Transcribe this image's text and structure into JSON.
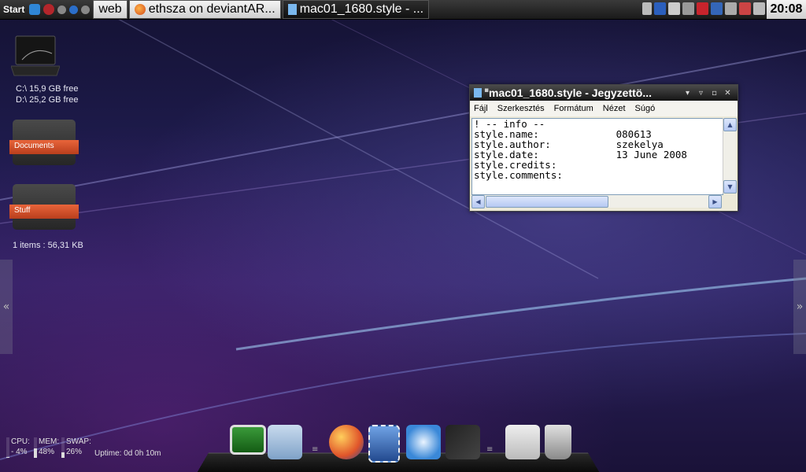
{
  "taskbar": {
    "start_label": "Start",
    "tasks": [
      {
        "label": "web"
      },
      {
        "label": "ethsza on deviantAR..."
      },
      {
        "label": "mac01_1680.style - ...",
        "active": true
      }
    ],
    "clock": "20:08"
  },
  "desktop": {
    "drives": [
      "C:\\ 15,9 GB free",
      "D:\\ 25,2 GB free"
    ],
    "folders": [
      {
        "label": "Documents"
      },
      {
        "label": "Stuff"
      }
    ],
    "items_info": "1 items : 56,31 KB",
    "left_arrow": "«",
    "right_arrow": "»"
  },
  "notepad": {
    "title": "mac01_1680.style - Jegyzettö...",
    "menu": [
      "Fájl",
      "Szerkesztés",
      "Formátum",
      "Nézet",
      "Súgó"
    ],
    "lines": [
      "! -- info --",
      "style.name:             080613",
      "style.author:           szekelya",
      "style.date:             13 June 2008",
      "style.credits:",
      "style.comments:"
    ]
  },
  "meters": {
    "cpu_label": "CPU:",
    "cpu_value": "- 4%",
    "cpu_percent": 4,
    "mem_label": "MEM:",
    "mem_value": "48%",
    "mem_percent": 48,
    "swap_label": "SWAP:",
    "swap_value": "26%",
    "swap_percent": 26,
    "uptime": "Uptime: 0d 0h 10m"
  },
  "dock": {
    "icons": [
      "monitor-icon",
      "documents-folder-icon",
      "firefox-icon",
      "mail-stamp-icon",
      "safari-icon",
      "winamp-icon",
      "system-app-icon",
      "trash-icon"
    ]
  },
  "colors": {
    "accent_folder": "#d9532b",
    "bg_dark": "#1f1c4f"
  }
}
